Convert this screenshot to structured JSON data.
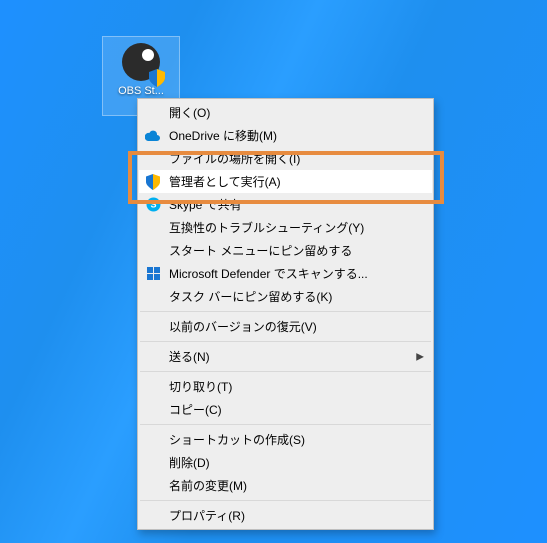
{
  "desktop_icon": {
    "label": "OBS St..."
  },
  "context_menu": {
    "items": [
      {
        "label": "開く(O)",
        "icon": null,
        "highlighted": false
      },
      {
        "label": "OneDrive に移動(M)",
        "icon": "cloud-icon",
        "highlighted": false
      },
      {
        "label": "ファイルの場所を開く(I)",
        "icon": null,
        "highlighted": false
      },
      {
        "label": "管理者として実行(A)",
        "icon": "shield-icon",
        "highlighted": true
      },
      {
        "label": "Skype で共有",
        "icon": "skype-icon",
        "highlighted": false
      },
      {
        "label": "互換性のトラブルシューティング(Y)",
        "icon": null,
        "highlighted": false
      },
      {
        "label": "スタート メニューにピン留めする",
        "icon": null,
        "highlighted": false
      },
      {
        "label": "Microsoft Defender でスキャンする...",
        "icon": "defender-icon",
        "highlighted": false
      },
      {
        "label": "タスク バーにピン留めする(K)",
        "icon": null,
        "highlighted": false
      },
      {
        "label": "以前のバージョンの復元(V)",
        "icon": null,
        "highlighted": false
      },
      {
        "label": "送る(N)",
        "icon": null,
        "submenu": true,
        "highlighted": false
      },
      {
        "label": "切り取り(T)",
        "icon": null,
        "highlighted": false
      },
      {
        "label": "コピー(C)",
        "icon": null,
        "highlighted": false
      },
      {
        "label": "ショートカットの作成(S)",
        "icon": null,
        "highlighted": false
      },
      {
        "label": "削除(D)",
        "icon": null,
        "highlighted": false
      },
      {
        "label": "名前の変更(M)",
        "icon": null,
        "highlighted": false
      },
      {
        "label": "プロパティ(R)",
        "icon": null,
        "highlighted": false
      }
    ]
  }
}
